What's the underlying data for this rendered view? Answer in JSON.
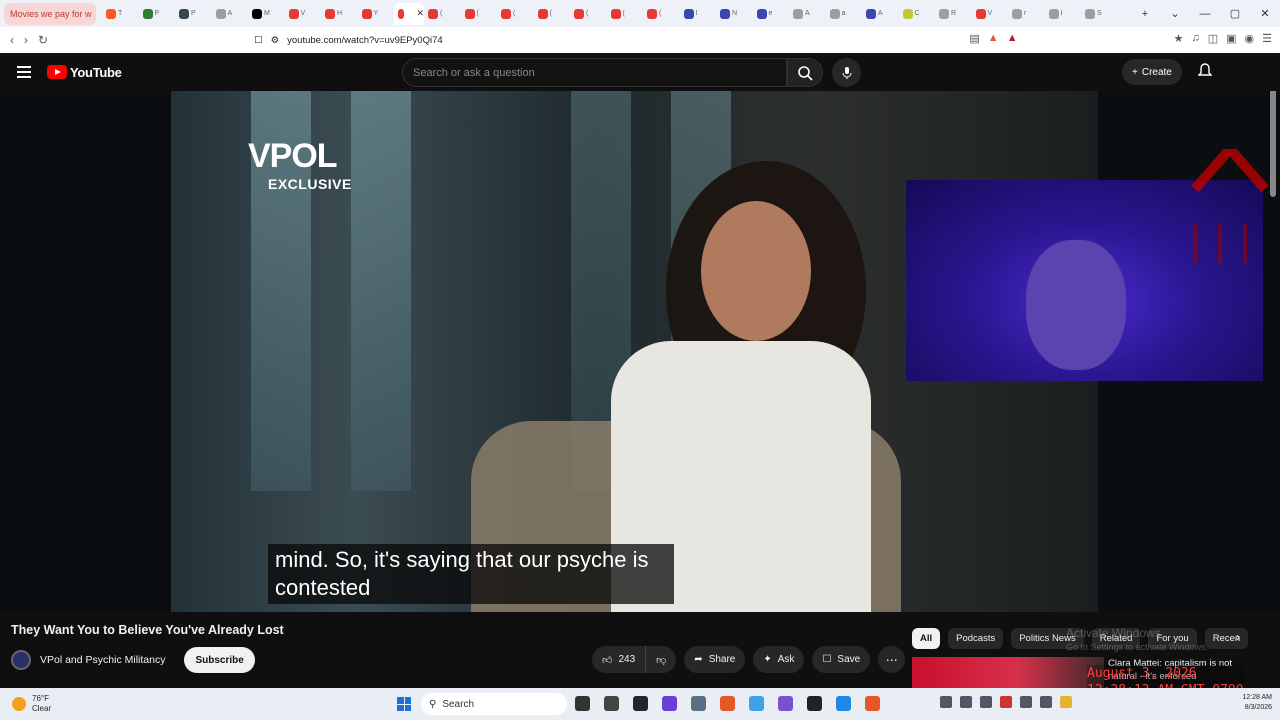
{
  "browser": {
    "first_tab_title": "Movies we pay for w",
    "url": "youtube.com/watch?v=uv9EPy0Qi74",
    "tabs": [
      {
        "title": "T",
        "color": "#ff5722"
      },
      {
        "title": "P",
        "color": "#2e7d32"
      },
      {
        "title": "P",
        "color": "#37474f"
      },
      {
        "title": "A",
        "color": "#9e9e9e"
      },
      {
        "title": "M",
        "color": "#000000"
      },
      {
        "title": "V",
        "color": "#e53935"
      },
      {
        "title": "H",
        "color": "#e53935"
      },
      {
        "title": "Y",
        "color": "#e53935"
      },
      {
        "title": "",
        "color": "#e53935"
      },
      {
        "title": "(",
        "color": "#e53935"
      },
      {
        "title": "(",
        "color": "#e53935"
      },
      {
        "title": "(",
        "color": "#e53935"
      },
      {
        "title": "(",
        "color": "#e53935"
      },
      {
        "title": "(",
        "color": "#e53935"
      },
      {
        "title": "(",
        "color": "#e53935"
      },
      {
        "title": "(",
        "color": "#e53935"
      },
      {
        "title": "I",
        "color": "#3949ab"
      },
      {
        "title": "N",
        "color": "#3949ab"
      },
      {
        "title": "e",
        "color": "#3949ab"
      },
      {
        "title": "A",
        "color": "#9e9e9e"
      },
      {
        "title": "a",
        "color": "#9e9e9e"
      },
      {
        "title": "A",
        "color": "#3949ab"
      },
      {
        "title": "C",
        "color": "#c0ca33"
      },
      {
        "title": "R",
        "color": "#9e9e9e"
      },
      {
        "title": "V",
        "color": "#e53935"
      },
      {
        "title": "r",
        "color": "#9e9e9e"
      },
      {
        "title": "I",
        "color": "#9e9e9e"
      },
      {
        "title": "S",
        "color": "#9e9e9e"
      }
    ],
    "active_tab_close": "✕",
    "new_tab": "+",
    "controls": {
      "dropdown": "⌄",
      "minimize": "—",
      "maximize": "▢",
      "close": "✕"
    }
  },
  "youtube": {
    "logo_text": "YouTube",
    "search_placeholder": "Search or ask a question",
    "create_label": "Create",
    "create_plus": "+",
    "video": {
      "overlay_brand": "VPOL",
      "overlay_tag": "EXCLUSIVE",
      "caption_line1": "mind. So, it's saying that our psyche is",
      "caption_line2": "contested"
    },
    "title": "They Want You to Believe You've Already Lost",
    "channel": "VPol and Psychic Militancy",
    "subscribe_label": "Subscribe",
    "likes": "243",
    "share_label": "Share",
    "ask_label": "Ask",
    "save_label": "Save",
    "chips": [
      "All",
      "Podcasts",
      "Politics News",
      "Related",
      "For you",
      "Recen"
    ],
    "reco_title": "Clara Mattei: capitalism is not natural - it's enforced",
    "windows_watermark_line1": "Activate Windows",
    "windows_watermark_line2": "Go to Settings to activate Windows."
  },
  "stamp": {
    "date": "August 3, 2026",
    "time": "12:28:13 AM GMT-0700"
  },
  "taskbar": {
    "temp": "76°F",
    "condition": "Clear",
    "search_label": "Search",
    "time": "12:28 AM",
    "date": "8/3/2026"
  }
}
